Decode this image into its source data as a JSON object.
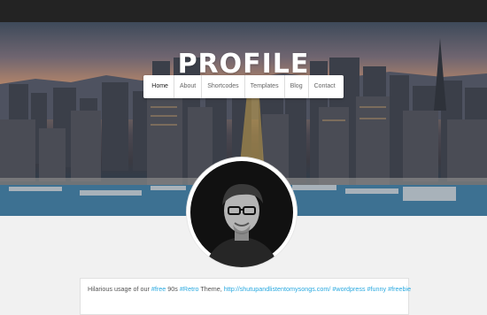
{
  "site": {
    "logo": "PROFILE"
  },
  "nav": {
    "items": [
      {
        "label": "Home",
        "active": true
      },
      {
        "label": "About"
      },
      {
        "label": "Shortcodes"
      },
      {
        "label": "Templates"
      },
      {
        "label": "Blog"
      },
      {
        "label": "Contact"
      }
    ]
  },
  "hero": {
    "description_icon": "city-skyline-image"
  },
  "avatar": {
    "icon": "user-portrait-photo"
  },
  "bio": {
    "part1": "Hilarious usage of our ",
    "tag1": "#free",
    "part2": " 90s ",
    "tag2": "#Retro",
    "part3": " Theme, ",
    "url": "http://shutupandlistentomysongs.com/",
    "part4": "  ",
    "tag3": "#wordpress",
    "part5": " ",
    "tag4": "#funny",
    "part6": " ",
    "tag5": "#freebie"
  },
  "colors": {
    "accent": "#29a9e0",
    "topbar": "#232323",
    "background": "#f1f1f1"
  }
}
